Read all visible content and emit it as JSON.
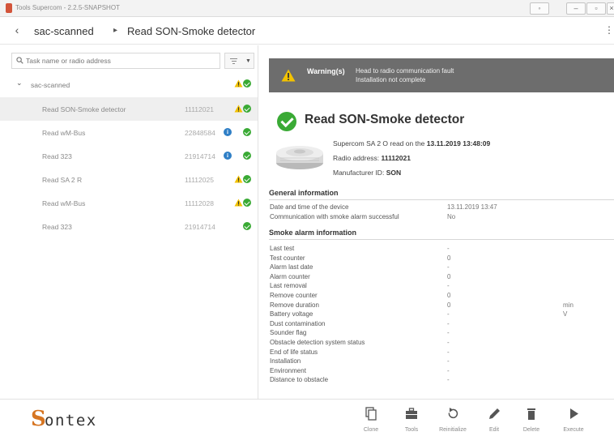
{
  "window": {
    "title": "Tools Supercom - 2.2.5-SNAPSHOT",
    "restore_label": "◦",
    "minimize_label": "–",
    "maximize_label": "▫",
    "close_label": "×"
  },
  "breadcrumb": {
    "back_label": "‹",
    "parent": "sac-scanned",
    "separator": "▸",
    "current": "Read SON-Smoke detector",
    "menu_label": "⋮"
  },
  "search": {
    "placeholder": "Task name or radio address"
  },
  "tree": {
    "group_name": "sac-scanned",
    "group_status": [
      "warning",
      "ok"
    ],
    "items": [
      {
        "name": "Read SON-Smoke detector",
        "address": "11112021",
        "status": [
          "warning",
          "ok"
        ],
        "selected": true
      },
      {
        "name": "Read wM-Bus",
        "address": "22848584",
        "status": [
          "info",
          "ok"
        ],
        "selected": false
      },
      {
        "name": "Read 323",
        "address": "21914714",
        "status": [
          "info",
          "ok"
        ],
        "selected": false
      },
      {
        "name": "Read SA 2 R",
        "address": "11112025",
        "status": [
          "warning",
          "ok"
        ],
        "selected": false
      },
      {
        "name": "Read wM-Bus",
        "address": "11112028",
        "status": [
          "warning",
          "ok"
        ],
        "selected": false
      },
      {
        "name": "Read 323",
        "address": "21914714",
        "status": [
          "ok"
        ],
        "selected": false
      }
    ]
  },
  "warning": {
    "label": "Warning(s)",
    "messages": [
      "Head to radio communication fault",
      "Installation not complete"
    ]
  },
  "device": {
    "title": "Read SON-Smoke detector",
    "read_prefix": "Supercom SA 2 O read on the",
    "read_date": "13.11.2019 13:48:09",
    "radio_label": "Radio address:",
    "radio_value": "11112021",
    "manufacturer_label": "Manufacturer ID:",
    "manufacturer_value": "SON"
  },
  "general": {
    "title": "General information",
    "rows": [
      {
        "key": "Date and time of the device",
        "value": "13.11.2019 13:47",
        "unit": ""
      },
      {
        "key": "Communication with smoke alarm successful",
        "value": "No",
        "unit": ""
      }
    ]
  },
  "smoke": {
    "title": "Smoke alarm information",
    "rows": [
      {
        "key": "Last test",
        "value": "-",
        "unit": ""
      },
      {
        "key": "Test counter",
        "value": "0",
        "unit": ""
      },
      {
        "key": "Alarm last date",
        "value": "-",
        "unit": ""
      },
      {
        "key": "Alarm counter",
        "value": "0",
        "unit": ""
      },
      {
        "key": "Last removal",
        "value": "-",
        "unit": ""
      },
      {
        "key": "Remove counter",
        "value": "0",
        "unit": ""
      },
      {
        "key": "Remove duration",
        "value": "0",
        "unit": "min"
      },
      {
        "key": "Battery voltage",
        "value": "-",
        "unit": "V"
      },
      {
        "key": "Dust contamination",
        "value": "-",
        "unit": ""
      },
      {
        "key": "Sounder flag",
        "value": "-",
        "unit": ""
      },
      {
        "key": "Obstacle detection system status",
        "value": "-",
        "unit": ""
      },
      {
        "key": "End of life status",
        "value": "-",
        "unit": ""
      },
      {
        "key": "Installation",
        "value": "-",
        "unit": ""
      },
      {
        "key": "Environment",
        "value": "-",
        "unit": ""
      },
      {
        "key": "Distance to obstacle",
        "value": "-",
        "unit": ""
      }
    ]
  },
  "logo": {
    "initial": "S",
    "rest": "ontex"
  },
  "toolbar": {
    "items": [
      {
        "label": "Clone",
        "icon": "clone-icon"
      },
      {
        "label": "Tools",
        "icon": "toolbox-icon"
      },
      {
        "label": "Reinitialize",
        "icon": "reinitialize-icon"
      },
      {
        "label": "Edit",
        "icon": "pencil-icon"
      },
      {
        "label": "Delete",
        "icon": "trash-icon"
      },
      {
        "label": "Execute",
        "icon": "play-icon"
      }
    ]
  },
  "colors": {
    "ok": "#3aaa35",
    "warning": "#f2c200",
    "info": "#2f7fc6",
    "banner": "#6d6d6d",
    "brand": "#d67522"
  }
}
